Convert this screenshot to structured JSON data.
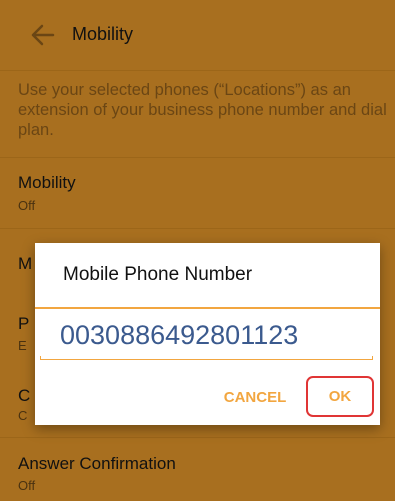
{
  "app_bar": {
    "title": "Mobility",
    "back_icon": "arrow-left-icon"
  },
  "page": {
    "description": "Use your selected phones (“Locations”) as an extension of your business phone number and dial plan.",
    "settings": [
      {
        "title": "Mobility",
        "subtitle": "Off"
      },
      {
        "title": "M",
        "subtitle": ""
      },
      {
        "title": "P",
        "subtitle": "E"
      },
      {
        "title": "C",
        "subtitle": "C"
      },
      {
        "title": "Answer Confirmation",
        "subtitle": "Off"
      }
    ]
  },
  "dialog": {
    "title": "Mobile Phone Number",
    "input_value": "0030886492801123",
    "cancel_label": "CANCEL",
    "ok_label": "OK"
  },
  "colors": {
    "accent": "#f2a640",
    "dimmed_background": "#a86f1f",
    "input_text": "#3b5a8e",
    "highlight_box": "#e03535"
  }
}
